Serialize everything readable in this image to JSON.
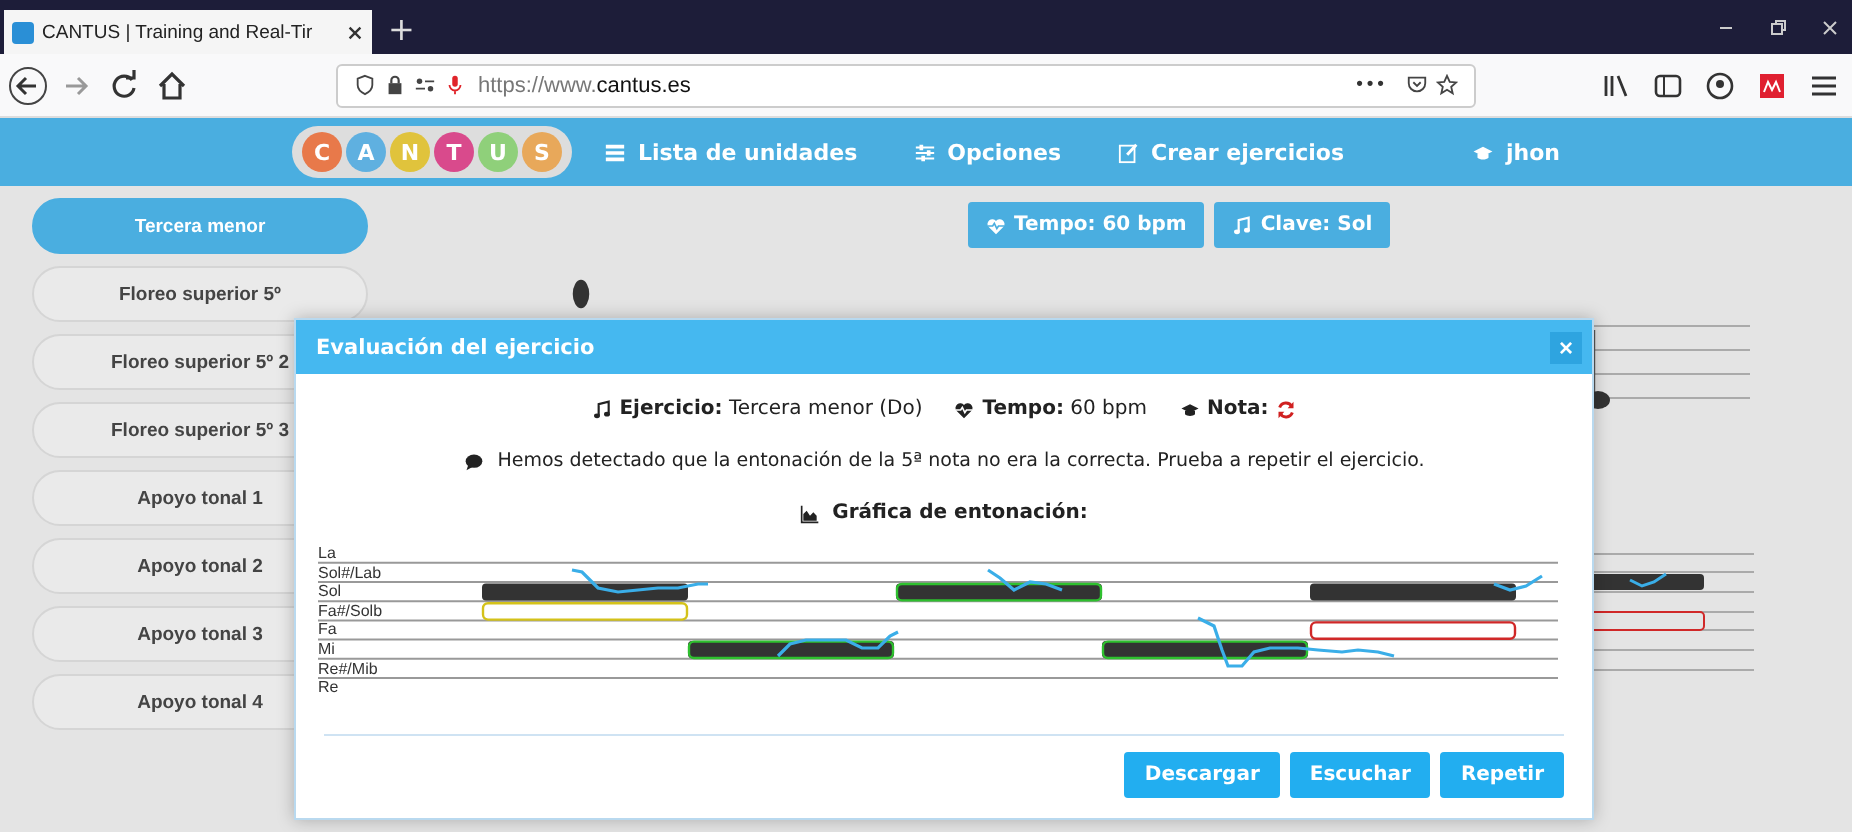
{
  "browser": {
    "tab_title": "CANTUS | Training and Real-Tir",
    "new_tab": "+",
    "url_prefix": "https://www.",
    "url_domain": "cantus.es",
    "more": "•••"
  },
  "navbar": {
    "logo_letters": [
      {
        "letter": "C",
        "color": "#e8794a"
      },
      {
        "letter": "A",
        "color": "#5fb0e0"
      },
      {
        "letter": "N",
        "color": "#e0c33c"
      },
      {
        "letter": "T",
        "color": "#d94a8c"
      },
      {
        "letter": "U",
        "color": "#8fd07a"
      },
      {
        "letter": "S",
        "color": "#e8a85a"
      }
    ],
    "items": [
      {
        "label": "Lista de unidades",
        "kind": "list"
      },
      {
        "label": "Opciones",
        "kind": "options"
      },
      {
        "label": "Crear ejercicios",
        "kind": "edit"
      },
      {
        "label": "jhon",
        "kind": "user"
      }
    ]
  },
  "sidebar": {
    "items": [
      {
        "label": "Tercera menor",
        "selected": true
      },
      {
        "label": "Floreo superior 5º",
        "selected": false
      },
      {
        "label": "Floreo superior 5º 2",
        "selected": false
      },
      {
        "label": "Floreo superior 5º 3",
        "selected": false
      },
      {
        "label": "Apoyo tonal 1",
        "selected": false
      },
      {
        "label": "Apoyo tonal 2",
        "selected": false
      },
      {
        "label": "Apoyo tonal 3",
        "selected": false
      },
      {
        "label": "Apoyo tonal 4",
        "selected": false
      }
    ]
  },
  "toolbar": {
    "tempo": "Tempo: 60 bpm",
    "clave": "Clave: Sol"
  },
  "dialog": {
    "title": "Evaluación del ejercicio",
    "close": "×",
    "exercise_label": "Ejercicio:",
    "exercise_value": "Tercera menor (Do)",
    "tempo_label": "Tempo:",
    "tempo_value": "60 bpm",
    "grade_label": "Nota:",
    "message": "Hemos detectado que la entonación de la 5ª nota no era la correcta. Prueba a repetir el ejercicio.",
    "chart_title": "Gráfica de entonación:",
    "pitch_chart": {
      "rows": [
        "La",
        "Sol#/Lab",
        "Sol",
        "Fa#/Solb",
        "Fa",
        "Mi",
        "Re#/Mib",
        "Re"
      ],
      "notes": [
        {
          "color": "#d4c21a"
        },
        {
          "color": "#2ec02e"
        },
        {
          "color": "#2ec02e"
        },
        {
          "color": "#2ec02e"
        },
        {
          "color": "#d02828"
        }
      ]
    },
    "buttons": [
      "Descargar",
      "Escuchar",
      "Repetir"
    ]
  }
}
